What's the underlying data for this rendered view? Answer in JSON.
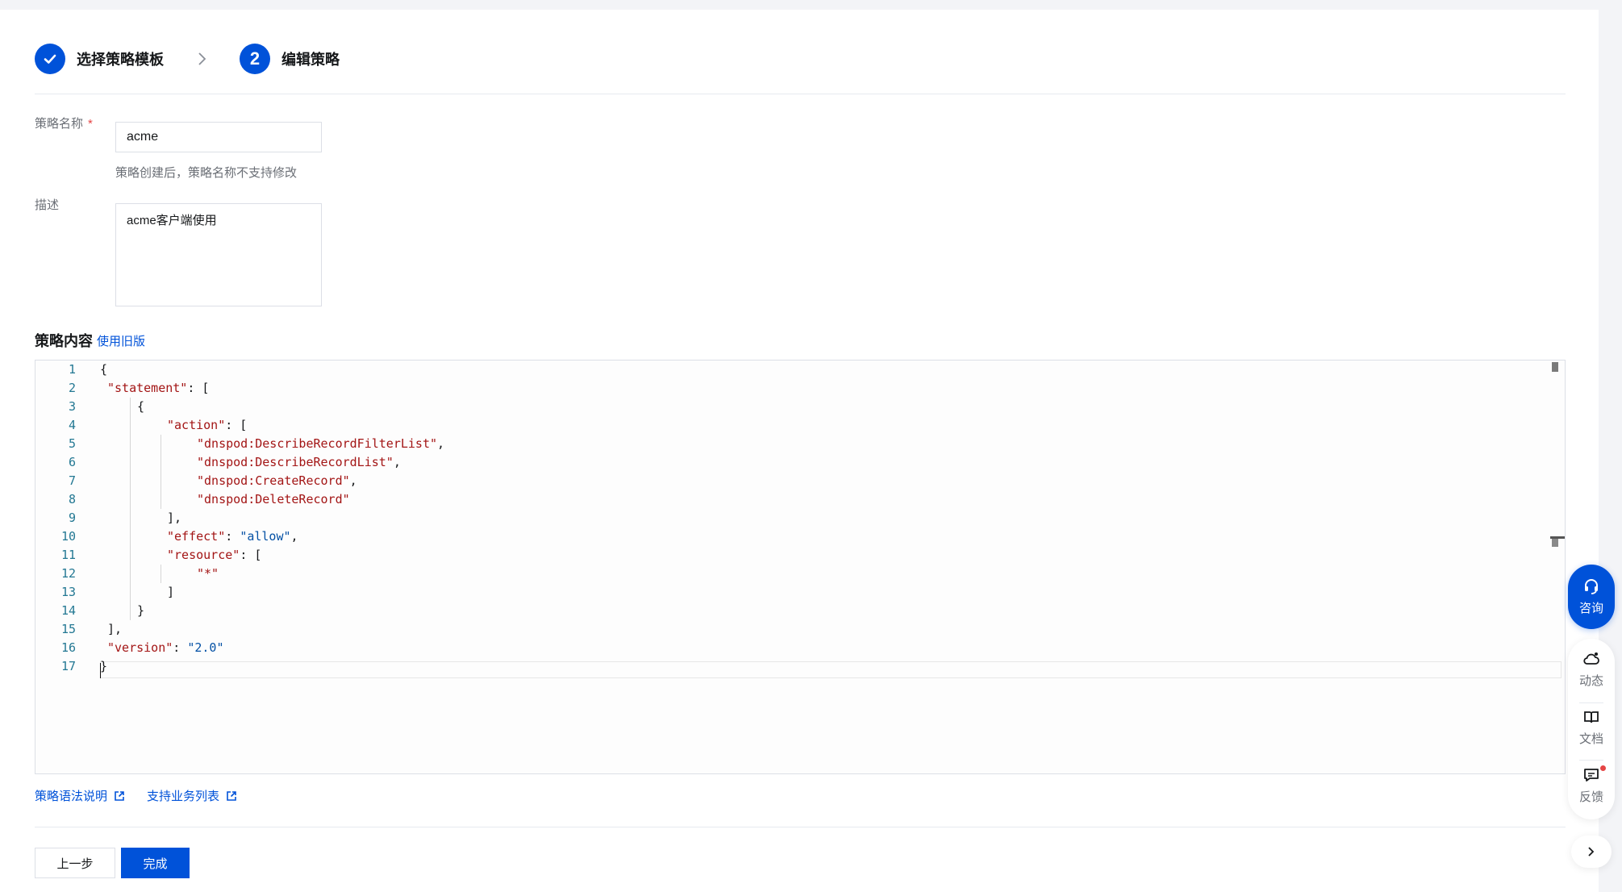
{
  "steps": [
    {
      "label": "选择策略模板",
      "state": "completed"
    },
    {
      "label": "编辑策略",
      "number": "2",
      "state": "current"
    }
  ],
  "form": {
    "name_label": "策略名称",
    "required_mark": "*",
    "name_value": "acme",
    "name_help": "策略创建后，策略名称不支持修改",
    "desc_label": "描述",
    "desc_value": "acme客户端使用"
  },
  "policy": {
    "title": "策略内容",
    "legacy_link": "使用旧版",
    "line_numbers": [
      "1",
      "2",
      "3",
      "4",
      "5",
      "6",
      "7",
      "8",
      "9",
      "10",
      "11",
      "12",
      "13",
      "14",
      "15",
      "16",
      "17"
    ],
    "code": {
      "l1": "{",
      "l2_key": "\"statement\"",
      "l2_rest": ": [",
      "l3": "{",
      "l4_key": "\"action\"",
      "l4_rest": ": [",
      "l5_str": "\"dnspod:DescribeRecordFilterList\"",
      "l5_rest": ",",
      "l6_str": "\"dnspod:DescribeRecordList\"",
      "l6_rest": ",",
      "l7_str": "\"dnspod:CreateRecord\"",
      "l7_rest": ",",
      "l8_str": "\"dnspod:DeleteRecord\"",
      "l9": "],",
      "l10_key": "\"effect\"",
      "l10_sep": ": ",
      "l10_val": "\"allow\"",
      "l10_rest": ",",
      "l11_key": "\"resource\"",
      "l11_rest": ": [",
      "l12_str": "\"*\"",
      "l13": "]",
      "l14": "}",
      "l15": "],",
      "l16_key": "\"version\"",
      "l16_sep": ": ",
      "l16_val": "\"2.0\"",
      "l17": "}"
    }
  },
  "links": {
    "syntax": "策略语法说明",
    "services": "支持业务列表"
  },
  "buttons": {
    "prev": "上一步",
    "done": "完成"
  },
  "sidebar_tools": {
    "consult": "咨询",
    "activity": "动态",
    "docs": "文档",
    "feedback": "反馈"
  },
  "colors": {
    "primary": "#0052d9",
    "string": "#a31515",
    "value": "#0451a5",
    "line_number": "#237893"
  }
}
